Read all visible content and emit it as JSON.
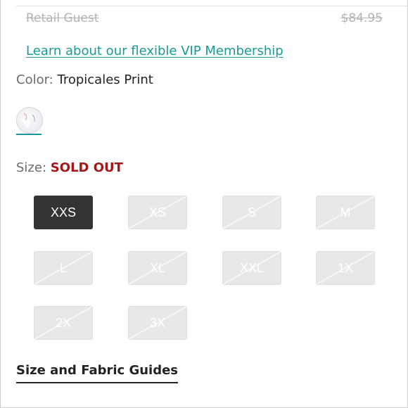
{
  "pricing": {
    "retail_label": "Retail Guest",
    "retail_price": "$84.95"
  },
  "vip_link": "Learn about our flexible VIP Membership",
  "color": {
    "label": "Color:",
    "value": "Tropicales Print",
    "swatch_name": "tropicales-print-swatch"
  },
  "size": {
    "label": "Size:",
    "status": "SOLD OUT",
    "selected": "XXS",
    "options": [
      "XXS",
      "XS",
      "S",
      "M",
      "L",
      "XL",
      "XXL",
      "1X",
      "2X",
      "3X"
    ]
  },
  "guides_link": "Size and Fabric Guides",
  "colors": {
    "link": "#1a9a96",
    "sold_out": "#a31818",
    "selected_bg": "#333333",
    "disabled_bg": "#e8e8e8"
  }
}
